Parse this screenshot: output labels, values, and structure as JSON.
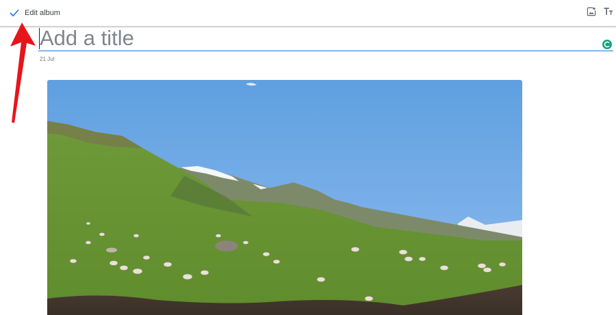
{
  "toolbar": {
    "done_label": "Edit album",
    "done_icon": "check-icon",
    "add_photos_icon": "add-photo-icon",
    "text_icon": "text-format-icon"
  },
  "album": {
    "title_placeholder": "Add a title",
    "title_value": "",
    "date": "21 Jul"
  },
  "colors": {
    "accent": "#1a73e8",
    "grammar_badge": "#15a37c",
    "annotation_arrow": "#e8141c"
  }
}
